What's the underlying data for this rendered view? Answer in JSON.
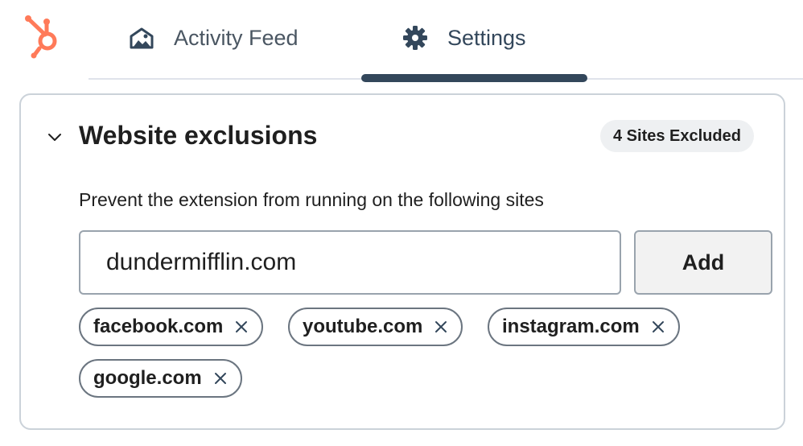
{
  "header": {
    "logo_icon": "hubspot-sprocket-icon",
    "tabs": [
      {
        "label": "Activity Feed",
        "icon": "activity-feed-icon",
        "active": false
      },
      {
        "label": "Settings",
        "icon": "gear-icon",
        "active": true
      }
    ]
  },
  "exclusions": {
    "title": "Website exclusions",
    "badge": "4 Sites Excluded",
    "description": "Prevent the extension from running on the following sites",
    "input_value": "dundermifflin.com",
    "add_label": "Add",
    "sites": [
      "facebook.com",
      "youtube.com",
      "instagram.com",
      "google.com"
    ]
  },
  "colors": {
    "brand_orange": "#ff7a59",
    "navy": "#33475b"
  }
}
